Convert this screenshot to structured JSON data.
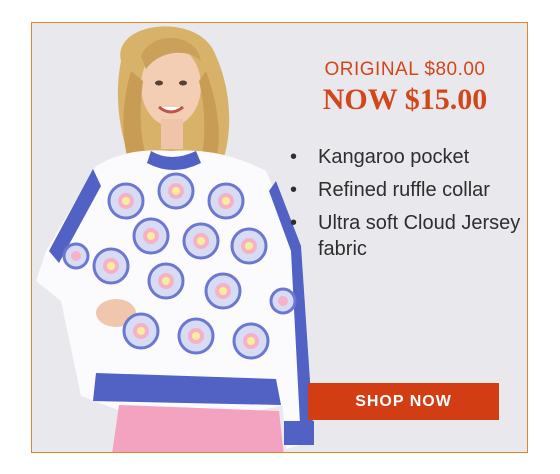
{
  "pricing": {
    "original": "ORIGINAL $80.00",
    "now": "NOW $15.00"
  },
  "features": [
    {
      "bullet": "•",
      "text": "Kangaroo pocket"
    },
    {
      "bullet": "•",
      "text": "Refined ruffle collar"
    },
    {
      "bullet": "•",
      "text": "Ultra soft Cloud Jersey fabric"
    }
  ],
  "cta": {
    "label": "SHOP NOW"
  },
  "colors": {
    "accent": "#d2461b",
    "border": "#e0822e",
    "panel_bg": "#e9e8ec",
    "button": "#d23d14",
    "sweater_trim": "#5161c4",
    "pants": "#f3a3c0"
  }
}
